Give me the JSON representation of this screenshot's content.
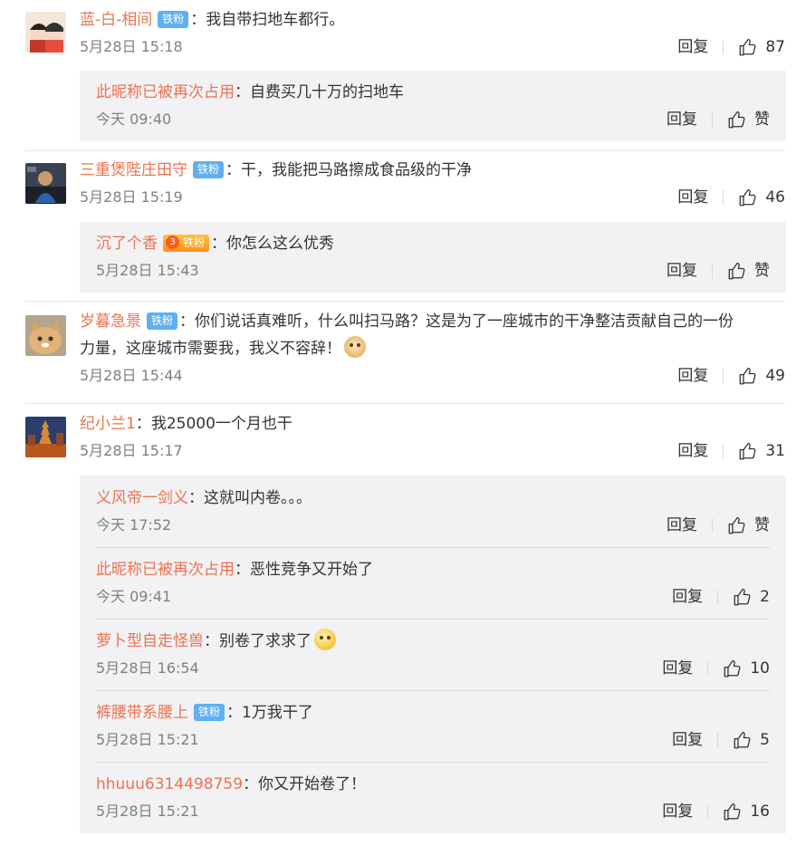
{
  "labels": {
    "reply": "回复"
  },
  "colors": {
    "username": "#eb7350",
    "badge": "#5fb0f0",
    "subpanel": "#f2f2f5"
  },
  "comments": [
    {
      "user": "蓝-白-相间",
      "badge": "铁粉",
      "text": "我自带扫地车都行。",
      "time": "5月28日 15:18",
      "likes": "87",
      "replies": [
        {
          "user": "此昵称已被再次占用",
          "text": "自费买几十万的扫地车",
          "time": "今天 09:40",
          "likes": "赞"
        }
      ]
    },
    {
      "user": "三重煲陛庄田守",
      "badge": "铁粉",
      "text": "干，我能把马路擦成食品级的干净",
      "time": "5月28日 15:19",
      "likes": "46",
      "replies": [
        {
          "user": "沉了个香",
          "badge": "铁粉",
          "text": "你怎么这么优秀",
          "time": "5月28日 15:43",
          "likes": "赞"
        }
      ]
    },
    {
      "user": "岁暮急景",
      "badge": "铁粉",
      "text1": "你们说话真难听，什么叫扫马路？这是为了一座城市的干净整洁贡献自己的一份",
      "text2": "力量，这座城市需要我，我义不容辞！",
      "time": "5月28日 15:44",
      "likes": "49"
    },
    {
      "user": "纪小兰1",
      "text": "我25000一个月也干",
      "time": "5月28日 15:17",
      "likes": "31",
      "replies": [
        {
          "user": "义风帝一剑义",
          "text": "这就叫内卷。。。",
          "time": "今天 17:52",
          "likes": "赞"
        },
        {
          "user": "此昵称已被再次占用",
          "text": "恶性竞争又开始了",
          "time": "今天 09:41",
          "likes": "2"
        },
        {
          "user": "萝卜型自走怪兽",
          "text": "别卷了求求了",
          "time": "5月28日 16:54",
          "likes": "10"
        },
        {
          "user": "裤腰带系腰上",
          "badge": "铁粉",
          "text": "1万我干了",
          "time": "5月28日 15:21",
          "likes": "5"
        },
        {
          "user": "hhuuu6314498759",
          "text": "你又开始卷了！",
          "time": "5月28日 15:21",
          "likes": "16"
        }
      ]
    }
  ]
}
